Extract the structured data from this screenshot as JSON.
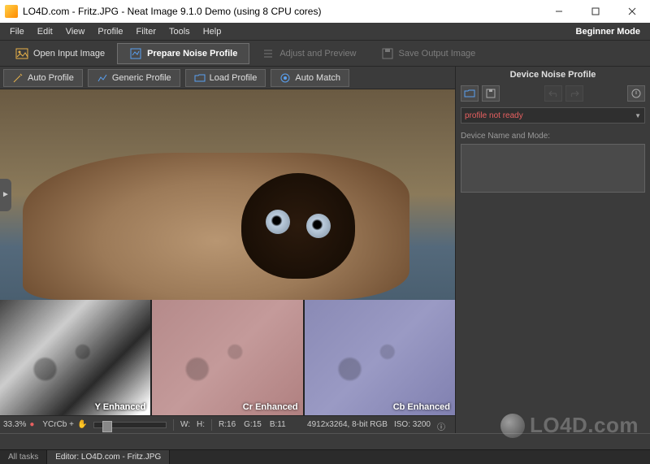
{
  "window": {
    "title": "LO4D.com - Fritz.JPG - Neat Image 9.1.0 Demo (using 8 CPU cores)"
  },
  "menubar": {
    "items": [
      "File",
      "Edit",
      "View",
      "Profile",
      "Filter",
      "Tools",
      "Help"
    ],
    "mode_label": "Beginner Mode"
  },
  "stages": {
    "open": {
      "label": "Open Input Image"
    },
    "prepare": {
      "label": "Prepare Noise Profile"
    },
    "adjust": {
      "label": "Adjust and Preview"
    },
    "save": {
      "label": "Save Output Image"
    }
  },
  "toolbar": {
    "auto_profile": "Auto Profile",
    "generic_profile": "Generic Profile",
    "load_profile": "Load Profile",
    "auto_match": "Auto Match"
  },
  "channels": {
    "y": "Y Enhanced",
    "cr": "Cr Enhanced",
    "cb": "Cb Enhanced"
  },
  "info": {
    "zoom": "33.3%",
    "color_mode": "YCrCb +",
    "w_label": "W:",
    "h_label": "H:",
    "r": "R:16",
    "g": "G:15",
    "b": "B:11",
    "dims": "4912x3264, 8-bit RGB",
    "iso": "ISO: 3200"
  },
  "side_panel": {
    "title": "Device Noise Profile",
    "profile_status": "profile not ready",
    "device_label": "Device Name and Mode:"
  },
  "bottom_tabs": {
    "all_tasks": "All tasks",
    "editor": "Editor: LO4D.com - Fritz.JPG"
  },
  "watermark": "LO4D.com"
}
